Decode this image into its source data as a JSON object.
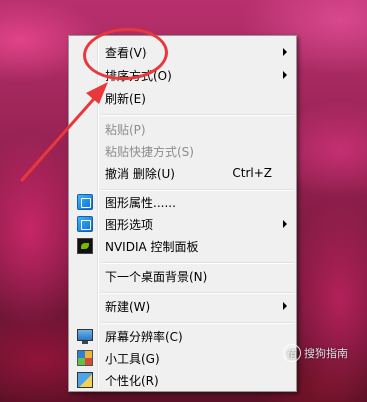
{
  "context_menu": {
    "items": [
      {
        "label": "查看(V)",
        "submenu": true
      },
      {
        "label": "排序方式(O)",
        "submenu": true
      },
      {
        "label": "刷新(E)"
      },
      {
        "label": "粘贴(P)",
        "disabled": true
      },
      {
        "label": "粘贴快捷方式(S)",
        "disabled": true
      },
      {
        "label": "撤消 删除(U)",
        "shortcut": "Ctrl+Z"
      },
      {
        "label": "图形属性......",
        "icon": "graphics-properties-icon"
      },
      {
        "label": "图形选项",
        "icon": "graphics-options-icon",
        "submenu": true
      },
      {
        "label": "NVIDIA 控制面板",
        "icon": "nvidia-icon"
      },
      {
        "label": "下一个桌面背景(N)"
      },
      {
        "label": "新建(W)",
        "submenu": true
      },
      {
        "label": "屏幕分辨率(C)",
        "icon": "screen-resolution-icon"
      },
      {
        "label": "小工具(G)",
        "icon": "gadgets-icon"
      },
      {
        "label": "个性化(R)",
        "icon": "personalize-icon"
      }
    ]
  },
  "watermark": {
    "icon_text": "值",
    "text": "搜狗指南"
  },
  "colors": {
    "annotation": "#e8383b",
    "menu_bg": "#f0f0f0",
    "disabled_text": "#8d8d8d"
  }
}
